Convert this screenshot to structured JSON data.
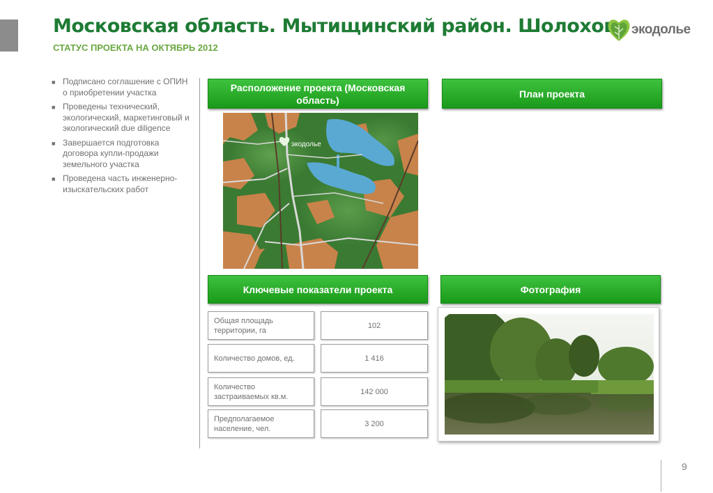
{
  "header": {
    "title": "Московская область. Мытищинский район. Шолохово",
    "subtitle": "СТАТУС ПРОЕКТА НА ОКТЯБРЬ 2012",
    "logo_text": "экодолье"
  },
  "bullets": [
    "Подписано соглашение с ОПИН о приобретении участка",
    "Проведены технический, экологический, маркетинговый и экологический due diligence",
    "Завершается подготовка договора купли-продажи земельного участка",
    "Проведена часть инженерно-изыскательских работ"
  ],
  "sections": {
    "location": "Расположение проекта (Московская область)",
    "plan": "План проекта",
    "indicators": "Ключевые показатели проекта",
    "photo": "Фотография"
  },
  "indicators": [
    {
      "label": "Общая площадь территории, га",
      "value": "102"
    },
    {
      "label": "Количество домов, ед.",
      "value": "1 416"
    },
    {
      "label": "Количество застраиваемых кв.м.",
      "value": "142 000"
    },
    {
      "label": "Предполагаемое население, чел.",
      "value": "3 200"
    }
  ],
  "map": {
    "marker_text": "экодолье"
  },
  "page_number": "9",
  "colors": {
    "title_green": "#1e7b34",
    "subtitle_green": "#6aa842",
    "button_green": "#2cb02c",
    "text_gray": "#707070"
  }
}
